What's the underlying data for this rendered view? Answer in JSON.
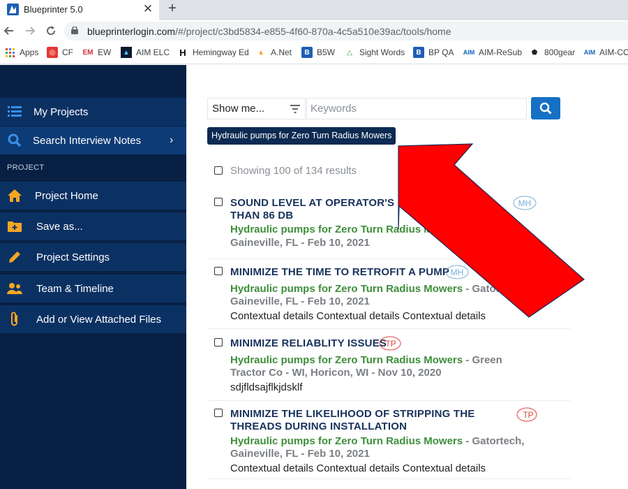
{
  "browser": {
    "tab_title": "Blueprinter 5.0",
    "tab_close": "✕",
    "new_tab": "+",
    "url_host": "blueprinterlogin.com",
    "url_path": "/#/project/c3bd5834-e855-4f60-870a-4c5a510e39ac/tools/home",
    "bookmarks": [
      "Apps",
      "CF",
      "EW",
      "AIM ELC",
      "Hemingway Ed",
      "A.Net",
      "B5W",
      "Sight Words",
      "BP QA",
      "AIM-ReSub",
      "800gear",
      "AIM-CC"
    ]
  },
  "sidebar": {
    "my_projects": "My Projects",
    "search_notes": "Search Interview Notes",
    "section_label": "PROJECT",
    "items": [
      {
        "label": "Project Home",
        "icon": "home-icon"
      },
      {
        "label": "Save as...",
        "icon": "folder-plus-icon"
      },
      {
        "label": "Project Settings",
        "icon": "pencil-icon"
      },
      {
        "label": "Team & Timeline",
        "icon": "team-icon"
      },
      {
        "label": "Add or View Attached Files",
        "icon": "paperclip-icon"
      }
    ]
  },
  "search": {
    "show_me": "Show me...",
    "placeholder": "Keywords",
    "chip": "Hydraulic pumps for Zero Turn Radius Mowers"
  },
  "results": {
    "summary": "Showing 100 of 134 results",
    "items": [
      {
        "title_line1": "SOUND LEVEL AT OPERATOR'S EAR",
        "title_line2": "THAN 86 DB",
        "project": "Hydraulic pumps for Zero Turn Radius Mowe",
        "company": "",
        "location": "Gaineville, FL - Feb 10, 2021",
        "details": "",
        "tag": "MH"
      },
      {
        "title_line1": "MINIMIZE THE TIME TO RETROFIT A PUMP",
        "project": "Hydraulic pumps for Zero Turn Radius Mowers",
        "company": " - Gatortec",
        "location": "Gaineville, FL - Feb 10, 2021",
        "details": "Contextual details Contextual details Contextual details",
        "tag": "MH"
      },
      {
        "title_line1": "MINIMIZE RELIABLITY ISSUES",
        "project": "Hydraulic pumps for Zero Turn Radius Mowers",
        "company": " - Green",
        "location": "Tractor Co - WI, Horicon, WI - Nov 10, 2020",
        "details": "sdjfldsajflkjdsklf",
        "tag": "TP"
      },
      {
        "title_line1": "MINIMIZE THE LIKELIHOOD OF STRIPPING THE",
        "title_line2": "THREADS DURING INSTALLATION",
        "project": "Hydraulic pumps for Zero Turn Radius Mowers",
        "company": " - Gatortech,",
        "location": "Gaineville, FL - Feb 10, 2021",
        "details": "Contextual details Contextual details Contextual details",
        "tag": "TP"
      }
    ]
  },
  "colors": {
    "sidebar_bg": "#072044",
    "sidebar_item": "#0b3163",
    "accent_blue": "#1670c4",
    "project_green": "#3e8e3a",
    "arrow_red": "#ff0000"
  }
}
